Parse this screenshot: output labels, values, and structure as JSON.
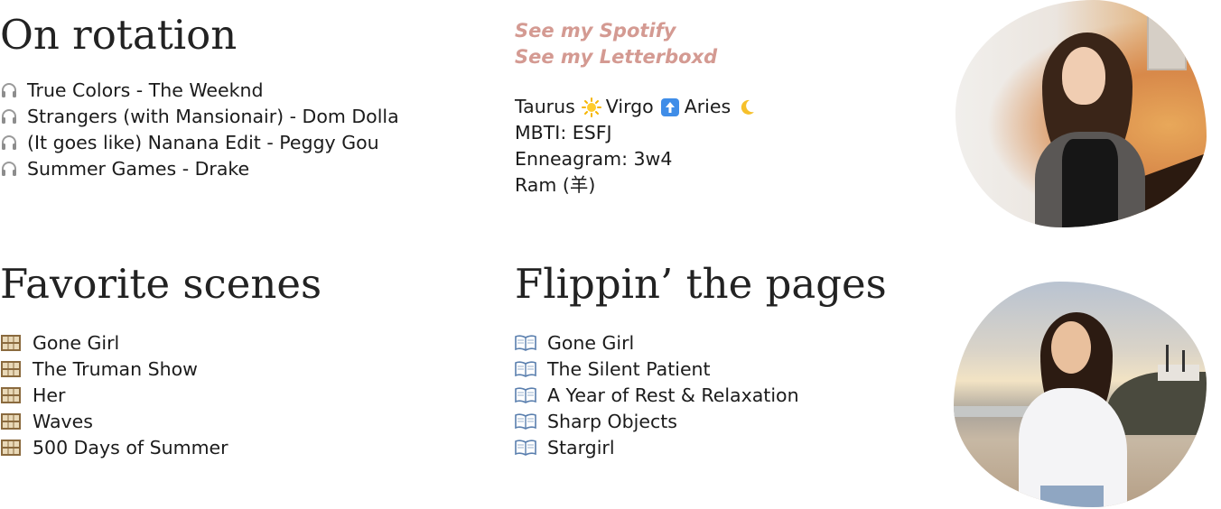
{
  "on_rotation": {
    "heading": "On rotation",
    "items": [
      {
        "icon": "headphones-icon",
        "text": "True Colors - The Weeknd"
      },
      {
        "icon": "headphones-icon",
        "text": "Strangers (with Mansionair) - Dom Dolla"
      },
      {
        "icon": "headphones-icon",
        "text": "(It goes like) Nanana Edit - Peggy Gou"
      },
      {
        "icon": "headphones-icon",
        "text": "Summer Games - Drake"
      }
    ]
  },
  "links": {
    "spotify": "See my Spotify",
    "letterboxd": "See my Letterboxd"
  },
  "traits": {
    "zodiac": {
      "sun": "Taurus",
      "rising": "Virgo",
      "moon": "Aries"
    },
    "mbti": "MBTI: ESFJ",
    "enneagram": "Enneagram: 3w4",
    "chinese_zodiac": "Ram (羊)"
  },
  "favorite_scenes": {
    "heading": "Favorite scenes",
    "items": [
      {
        "icon": "film-frames-icon",
        "text": "Gone Girl"
      },
      {
        "icon": "film-frames-icon",
        "text": "The Truman Show"
      },
      {
        "icon": "film-frames-icon",
        "text": "Her"
      },
      {
        "icon": "film-frames-icon",
        "text": "Waves"
      },
      {
        "icon": "film-frames-icon",
        "text": "500 Days of Summer"
      }
    ]
  },
  "flippin_pages": {
    "heading": "Flippin’ the pages",
    "items": [
      {
        "icon": "open-book-icon",
        "text": "Gone Girl"
      },
      {
        "icon": "open-book-icon",
        "text": "The Silent Patient"
      },
      {
        "icon": "open-book-icon",
        "text": "A Year of Rest & Relaxation"
      },
      {
        "icon": "open-book-icon",
        "text": "Sharp Objects"
      },
      {
        "icon": "open-book-icon",
        "text": "Stargirl"
      }
    ]
  },
  "colors": {
    "link": "#d49a92",
    "text": "#1b1b1b",
    "heading": "#222222"
  }
}
